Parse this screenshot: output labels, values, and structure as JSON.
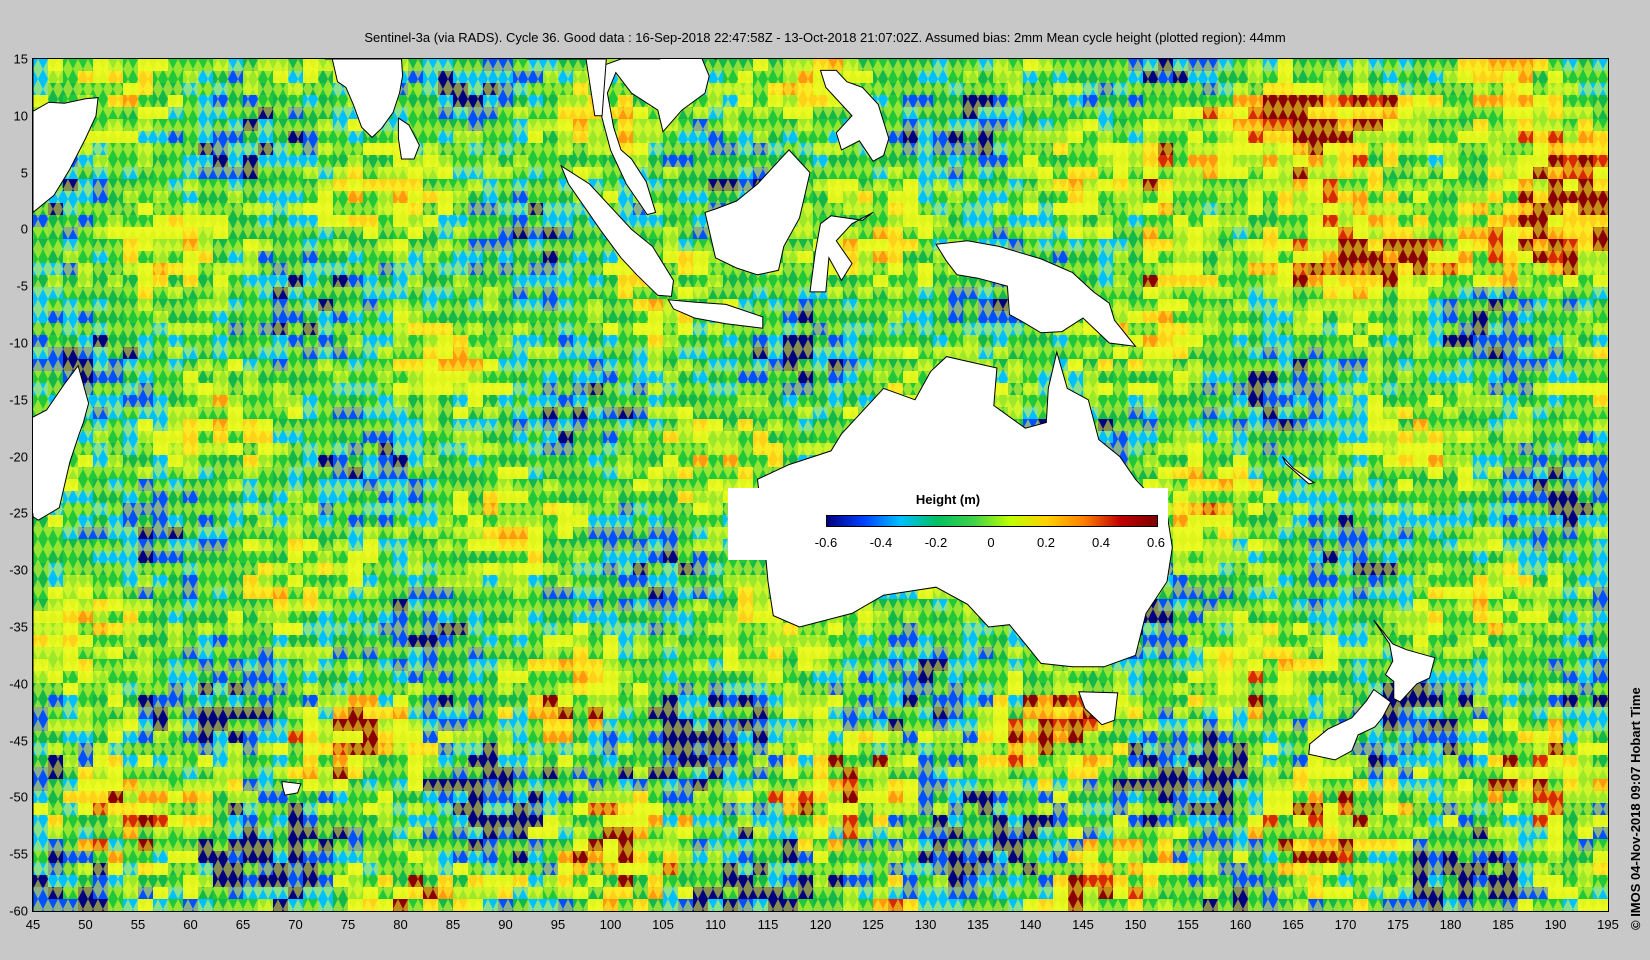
{
  "title": "Sentinel-3a (via RADS). Cycle 36. Good data : 16-Sep-2018 22:47:58Z - 13-Oct-2018 21:07:02Z. Assumed bias: 2mm  Mean cycle height (plotted region): 44mm",
  "copyright": "© IMOS 04-Nov-2018 09:07 Hobart Time",
  "map": {
    "lon_range": [
      45,
      195
    ],
    "lat_range": [
      -60,
      15
    ],
    "x_ticks": [
      "45",
      "50",
      "55",
      "60",
      "65",
      "70",
      "75",
      "80",
      "85",
      "90",
      "95",
      "100",
      "105",
      "110",
      "115",
      "120",
      "125",
      "130",
      "135",
      "140",
      "145",
      "150",
      "155",
      "160",
      "165",
      "170",
      "175",
      "180",
      "185",
      "190",
      "195"
    ],
    "y_ticks": [
      "15",
      "10",
      "5",
      "0",
      "-5",
      "-10",
      "-15",
      "-20",
      "-25",
      "-30",
      "-35",
      "-40",
      "-45",
      "-50",
      "-55",
      "-60"
    ]
  },
  "colorbar": {
    "title": "Height (m)",
    "ticks": [
      "-0.6",
      "-0.4",
      "-0.2",
      "0",
      "0.2",
      "0.4",
      "0.6"
    ],
    "colors": [
      "#00007f",
      "#0040ff",
      "#00bfff",
      "#00c060",
      "#3fd24a",
      "#bfff00",
      "#ffd000",
      "#ff8000",
      "#c00000",
      "#7f0000"
    ]
  }
}
